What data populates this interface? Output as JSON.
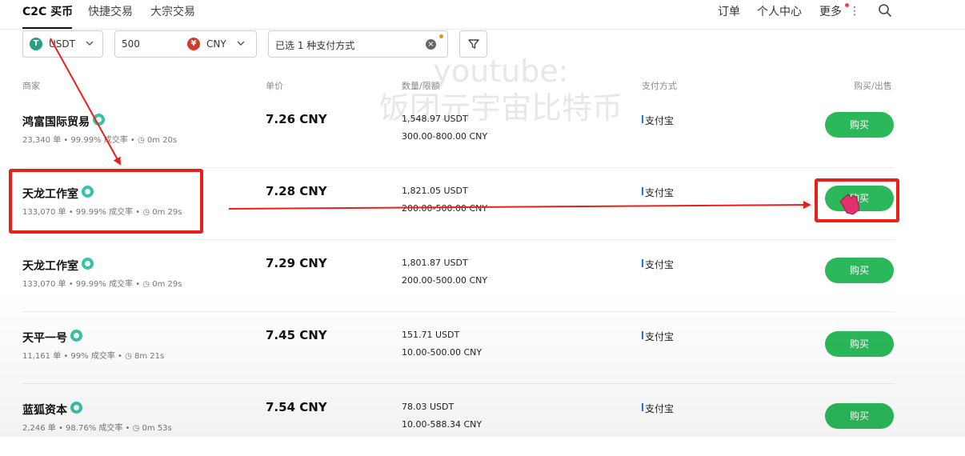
{
  "nav": {
    "tabs": [
      {
        "label": "C2C 买币",
        "active": true
      },
      {
        "label": "快捷交易"
      },
      {
        "label": "大宗交易"
      }
    ],
    "right": [
      "订单",
      "个人中心",
      "更多"
    ]
  },
  "filters": {
    "coin": "USDT",
    "coin_badge": "T",
    "amount": "500",
    "currency": "CNY",
    "currency_badge": "¥",
    "payment": "已选 1 种支付方式"
  },
  "table": {
    "headers": {
      "merchant": "商家",
      "price": "单价",
      "qty": "数量/限额",
      "pay": "支付方式",
      "action": "购买/出售"
    },
    "rows": [
      {
        "name": "鸿富国际贸易",
        "stats": "23,340 单 • 99.99% 成交率 • ◷ 0m 20s",
        "price": "7.26 CNY",
        "qty": "1,548.97 USDT",
        "limit": "300.00-800.00 CNY",
        "pay": "支付宝",
        "buy": "购买"
      },
      {
        "name": "天龙工作室",
        "stats": "133,070 单 • 99.99% 成交率 • ◷ 0m 29s",
        "price": "7.28 CNY",
        "qty": "1,821.05 USDT",
        "limit": "200.00-500.00 CNY",
        "pay": "支付宝",
        "buy": "购买"
      },
      {
        "name": "天龙工作室",
        "stats": "133,070 单 • 99.99% 成交率 • ◷ 0m 29s",
        "price": "7.29 CNY",
        "qty": "1,801.87 USDT",
        "limit": "200.00-500.00 CNY",
        "pay": "支付宝",
        "buy": "购买"
      },
      {
        "name": "天平一号",
        "stats": "11,161 单 • 99% 成交率 • ◷ 8m 21s",
        "price": "7.45 CNY",
        "qty": "151.71 USDT",
        "limit": "10.00-500.00 CNY",
        "pay": "支付宝",
        "buy": "购买"
      },
      {
        "name": "蓝狐资本",
        "stats": "2,246 单 • 98.76% 成交率 • ◷ 0m 53s",
        "price": "7.54 CNY",
        "qty": "78.03 USDT",
        "limit": "10.00-588.34 CNY",
        "pay": "支付宝",
        "buy": "购买"
      }
    ]
  },
  "watermark": {
    "line1": "youtube:",
    "line2": "饭团元宇宙比特币"
  },
  "colors": {
    "accent_green": "#2bb85a",
    "annotation_red": "#e8201a",
    "verified_teal": "#3dbfa9"
  }
}
